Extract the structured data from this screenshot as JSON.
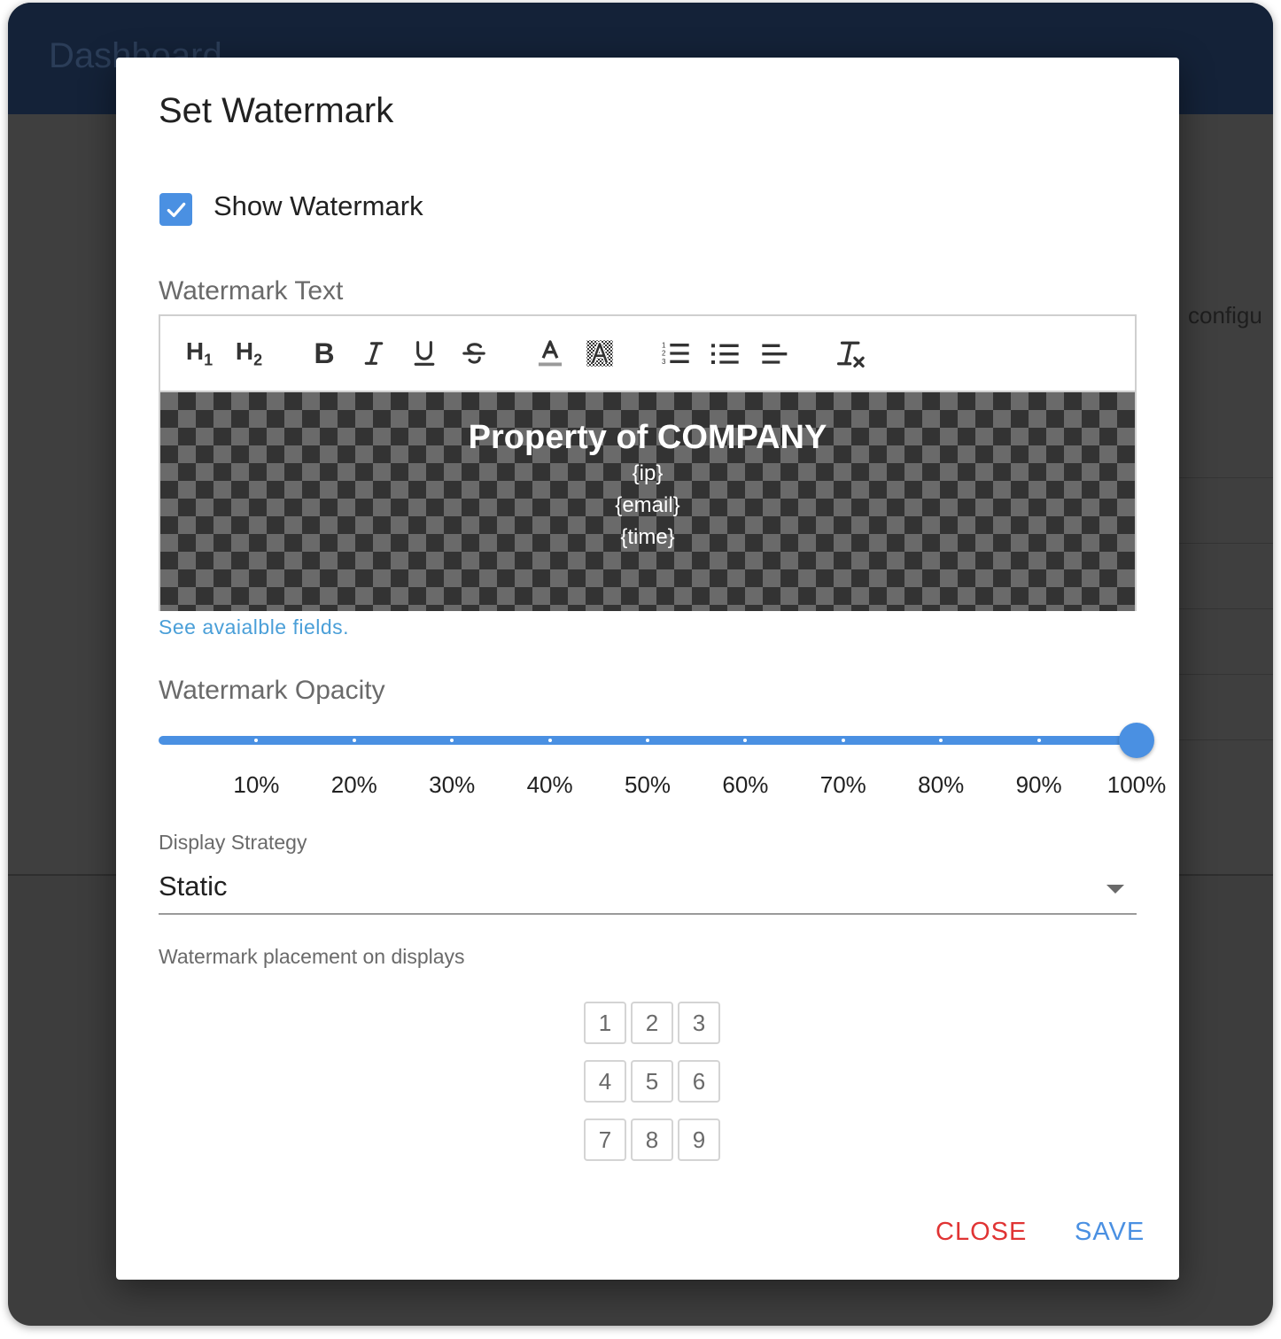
{
  "background": {
    "header_title": "Dashboard",
    "partial_text": "configu"
  },
  "dialog": {
    "title": "Set Watermark",
    "show_watermark": {
      "label": "Show Watermark",
      "checked": true
    },
    "watermark_text": {
      "label": "Watermark Text",
      "toolbar": [
        "heading-1",
        "heading-2",
        "bold",
        "italic",
        "underline",
        "strikethrough",
        "text-color",
        "highlight-color",
        "ordered-list",
        "bullet-list",
        "align-left",
        "clear-formatting"
      ],
      "content": {
        "title": "Property of COMPANY",
        "lines": [
          "{ip}",
          "{email}",
          "{time}"
        ]
      }
    },
    "fields_link": "See avaialble fields.",
    "opacity": {
      "label": "Watermark Opacity",
      "value_percent": 100,
      "ticks": [
        "10%",
        "20%",
        "30%",
        "40%",
        "50%",
        "60%",
        "70%",
        "80%",
        "90%",
        "100%"
      ]
    },
    "display_strategy": {
      "label": "Display Strategy",
      "value": "Static"
    },
    "placement": {
      "label": "Watermark placement on displays",
      "cells": [
        "1",
        "2",
        "3",
        "4",
        "5",
        "6",
        "7",
        "8",
        "9"
      ]
    },
    "actions": {
      "close": "CLOSE",
      "save": "SAVE"
    }
  },
  "colors": {
    "accent": "#4a90e2",
    "close": "#e03434",
    "link": "#4a9fd8"
  }
}
